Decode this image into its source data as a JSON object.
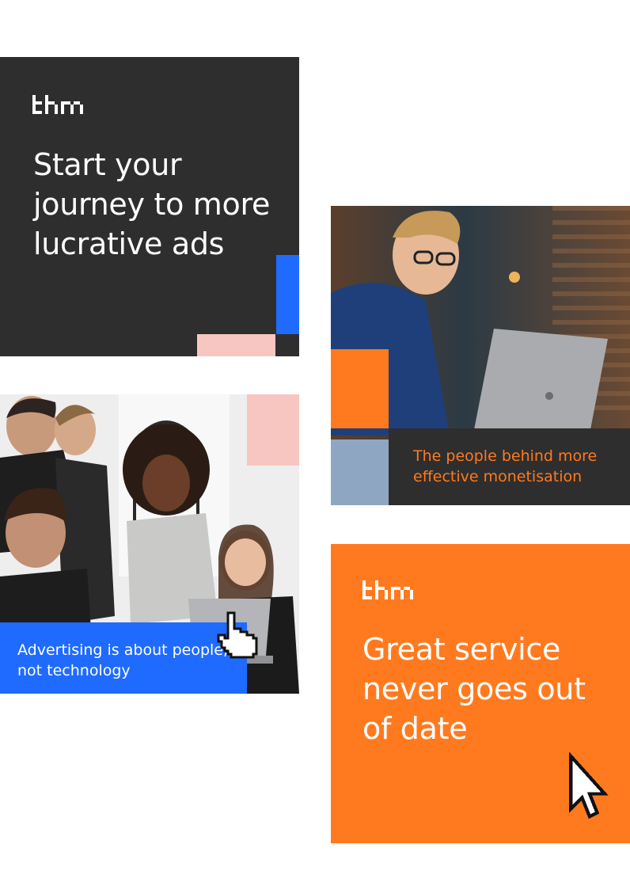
{
  "brand": {
    "logo_text": "thm",
    "orange": "#ff7a1f",
    "blue": "#1f6bff",
    "pink": "#f7c6c0",
    "dark": "#2e2e2e"
  },
  "card_dark": {
    "headline": "Start your journey to more lucrative ads"
  },
  "card_photo_man": {
    "caption": "The people behind more effective monetisation"
  },
  "card_photo_group": {
    "caption": "Advertising is about people, not technology"
  },
  "card_orange": {
    "headline": "Great service never goes out of date"
  },
  "icons": [
    "thm-logo-icon",
    "pixel-cursor-arrow-icon",
    "pixel-hand-pointer-icon"
  ]
}
